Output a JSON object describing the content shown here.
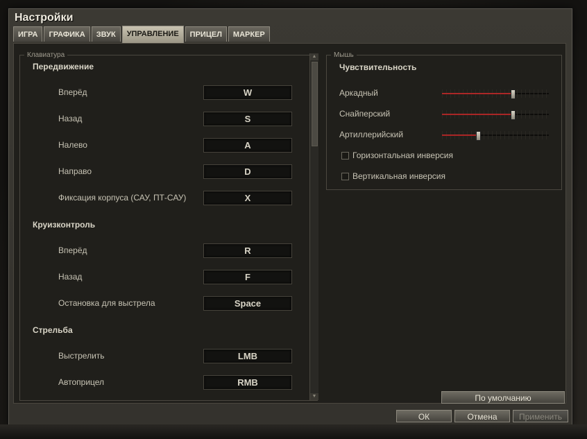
{
  "window": {
    "title": "Настройки"
  },
  "tabs": [
    {
      "label": "ИГРА",
      "active": false
    },
    {
      "label": "ГРАФИКА",
      "active": false
    },
    {
      "label": "ЗВУК",
      "active": false
    },
    {
      "label": "УПРАВЛЕНИЕ",
      "active": true
    },
    {
      "label": "ПРИЦЕЛ",
      "active": false
    },
    {
      "label": "МАРКЕР",
      "active": false
    }
  ],
  "keyboard": {
    "legend": "Клавиатура",
    "sections": [
      {
        "title": "Передвижение",
        "items": [
          {
            "label": "Вперёд",
            "key": "W"
          },
          {
            "label": "Назад",
            "key": "S"
          },
          {
            "label": "Налево",
            "key": "A"
          },
          {
            "label": "Направо",
            "key": "D"
          },
          {
            "label": "Фиксация корпуса (САУ, ПТ-САУ)",
            "key": "X"
          }
        ]
      },
      {
        "title": "Круизконтроль",
        "items": [
          {
            "label": "Вперёд",
            "key": "R"
          },
          {
            "label": "Назад",
            "key": "F"
          },
          {
            "label": "Остановка для выстрела",
            "key": "Space"
          }
        ]
      },
      {
        "title": "Стрельба",
        "items": [
          {
            "label": "Выстрелить",
            "key": "LMB"
          },
          {
            "label": "Автоприцел",
            "key": "RMB"
          }
        ]
      }
    ]
  },
  "mouse": {
    "legend": "Мышь",
    "title": "Чувствительность",
    "sliders": [
      {
        "label": "Аркадный",
        "value": 0.66
      },
      {
        "label": "Снайперский",
        "value": 0.66
      },
      {
        "label": "Артиллерийский",
        "value": 0.34
      }
    ],
    "checkboxes": [
      {
        "label": "Горизонтальная инверсия",
        "checked": false
      },
      {
        "label": "Вертикальная инверсия",
        "checked": false
      }
    ]
  },
  "buttons": {
    "defaults": "По умолчанию",
    "ok": "ОК",
    "cancel": "Отмена",
    "apply": "Применить"
  },
  "colors": {
    "slider_fill": "#cc3333",
    "accent": "#c9c3b1"
  }
}
